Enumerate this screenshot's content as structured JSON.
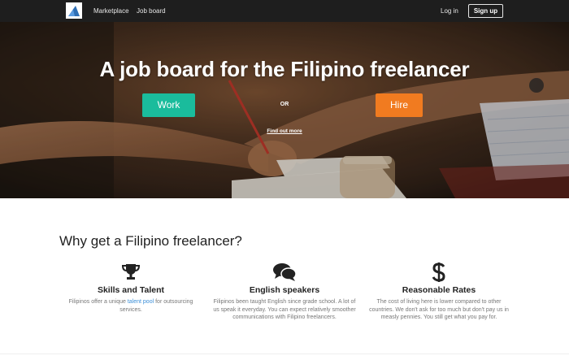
{
  "nav": {
    "links": [
      "Marketplace",
      "Job board"
    ],
    "login_label": "Log in",
    "signup_label": "Sign up"
  },
  "hero": {
    "title": "A job board for the Filipino freelancer",
    "work_label": "Work",
    "or_label": "OR",
    "hire_label": "Hire",
    "find_out_label": "Find out more"
  },
  "features": {
    "title": "Why get a Filipino freelancer?",
    "items": [
      {
        "icon": "trophy-icon",
        "title": "Skills and Talent",
        "text_before": "Filipinos offer a unique ",
        "link": "talent pool",
        "text_after": " for outsourcing services."
      },
      {
        "icon": "speech-bubbles-icon",
        "title": "English speakers",
        "text": "Filipinos been taught English since grade school. A lot of us speak it everyday. You can expect relatively smoother communications with Filipino freelancers."
      },
      {
        "icon": "dollar-icon",
        "title": "Reasonable Rates",
        "text": "The cost of living here is lower compared to other countries. We don't ask for too much but don't pay us in measly pennies. You still get what you pay for."
      }
    ]
  },
  "colors": {
    "nav_bg": "#1e1e1e",
    "work_button": "#1abc9c",
    "hire_button": "#f17b20",
    "link": "#3b8fd8"
  }
}
